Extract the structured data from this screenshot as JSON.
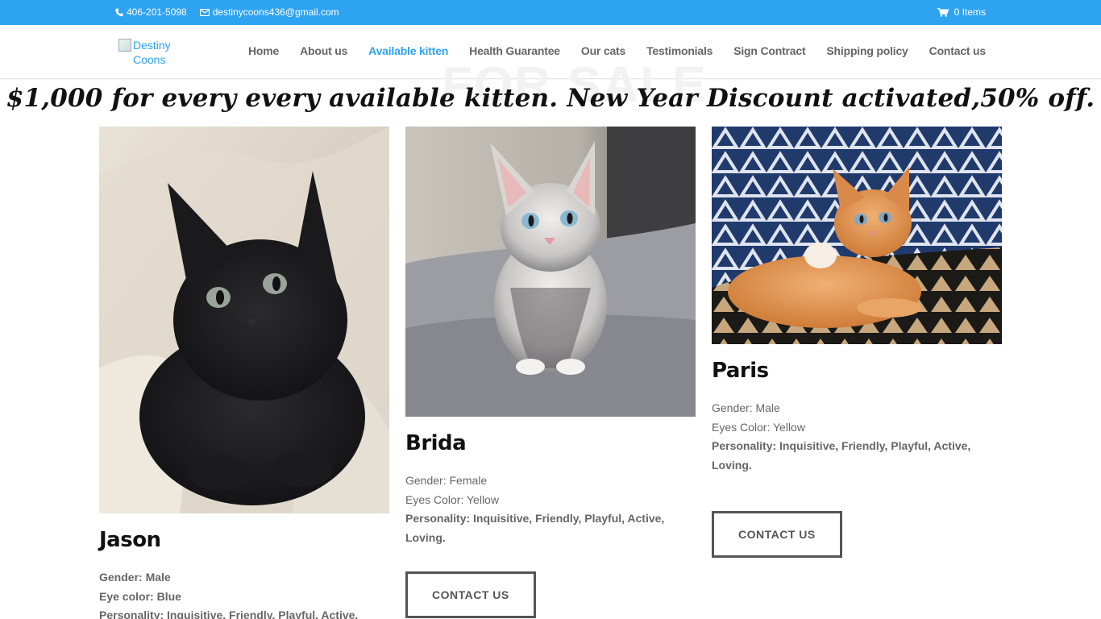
{
  "topbar": {
    "phone": "406-201-5098",
    "email": "destinycoons436@gmail.com",
    "cart": "0 Items"
  },
  "header": {
    "logo_alt": "Destiny Coons",
    "nav": [
      {
        "label": "Home",
        "active": false
      },
      {
        "label": "About us",
        "active": false
      },
      {
        "label": "Available kitten",
        "active": true
      },
      {
        "label": "Health Guarantee",
        "active": false
      },
      {
        "label": "Our cats",
        "active": false
      },
      {
        "label": "Testimonials",
        "active": false
      },
      {
        "label": "Sign Contract",
        "active": false
      },
      {
        "label": "Shipping policy",
        "active": false
      },
      {
        "label": "Contact us",
        "active": false
      }
    ]
  },
  "main": {
    "watermark": "FOR SALE",
    "banner": "$1,000 for every every available kitten. New Year Discount activated,50% off."
  },
  "kittens": [
    {
      "name": "Jason",
      "gender": "Gender: Male",
      "eyes": "Eye color: Blue",
      "personality": "Personality: Inquisitive, Friendly, Playful, Active, Loving."
    },
    {
      "name": "Brida",
      "gender": "Gender: Female",
      "eyes": "Eyes Color: Yellow",
      "personality": "Personality: Inquisitive, Friendly, Playful, Active, Loving.",
      "button": "CONTACT US"
    },
    {
      "name": "Paris",
      "gender": "Gender: Male",
      "eyes": "Eyes Color: Yellow",
      "personality": "Personality: Inquisitive, Friendly, Playful, Active, Loving.",
      "button": "CONTACT US"
    }
  ],
  "colors": {
    "accent": "#2ea3f2",
    "text": "#666666",
    "heading": "#111111"
  }
}
